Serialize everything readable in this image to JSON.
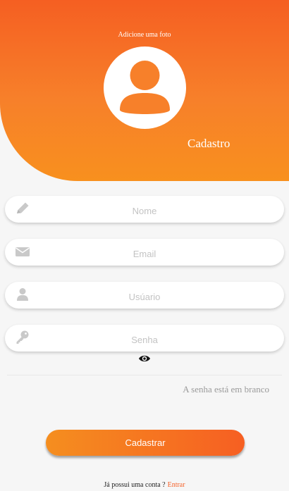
{
  "header": {
    "photo_label": "Adicione uma foto",
    "title": "Cadastro"
  },
  "form": {
    "name_placeholder": "Nome",
    "email_placeholder": "Email",
    "user_placeholder": "Usúario",
    "password_placeholder": "Senha",
    "error_message": "A senha está em branco",
    "submit_label": "Cadastrar"
  },
  "footer": {
    "question": "Já possui uma conta ?",
    "login_link": "Entrar"
  },
  "colors": {
    "accent_dark": "#f55f22",
    "accent_light": "#f8901e",
    "icon_gray": "#c9c9c9",
    "link": "#f5622a"
  },
  "icons": [
    "user-avatar-icon",
    "pencil-icon",
    "envelope-icon",
    "user-icon",
    "key-icon",
    "eye-icon"
  ]
}
